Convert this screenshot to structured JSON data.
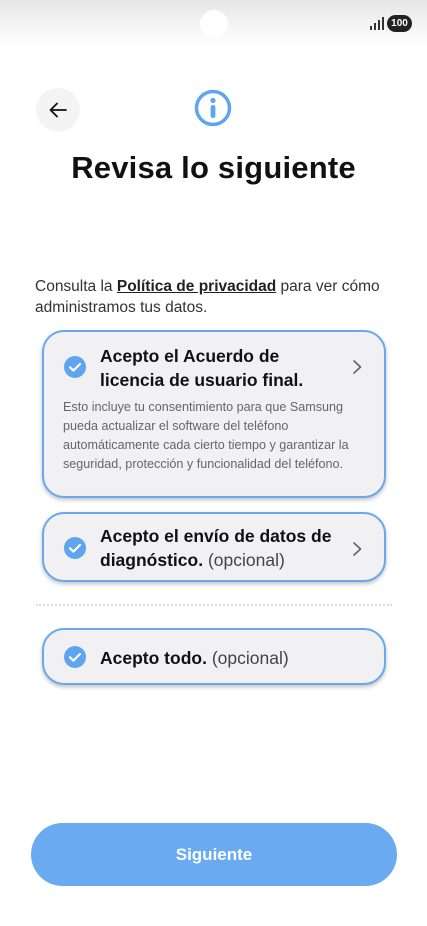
{
  "status_bar": {
    "battery": "100"
  },
  "header": {
    "title": "Revisa lo siguiente"
  },
  "intro": {
    "before_link": "Consulta la ",
    "link_text": "Política de privacidad",
    "after_link": " para ver cómo administramos tus datos."
  },
  "items": [
    {
      "title": "Acepto el Acuerdo de licencia de usuario final.",
      "description": "Esto incluye tu consentimiento para que Samsung pueda actualizar el software del teléfono automáticamente cada cierto tiempo y garantizar la seguridad, protección y funcionalidad del teléfono.",
      "checked": true
    },
    {
      "title": "Acepto el envío de datos de diagnóstico.",
      "optional": "(opcional)",
      "checked": true
    },
    {
      "title": "Acepto todo.",
      "optional": "(opcional)",
      "checked": true
    }
  ],
  "footer": {
    "next_label": "Siguiente"
  },
  "colors": {
    "accent": "#6aaaf0",
    "card_border": "#6aa8ee",
    "card_bg": "#f1f1f3"
  }
}
